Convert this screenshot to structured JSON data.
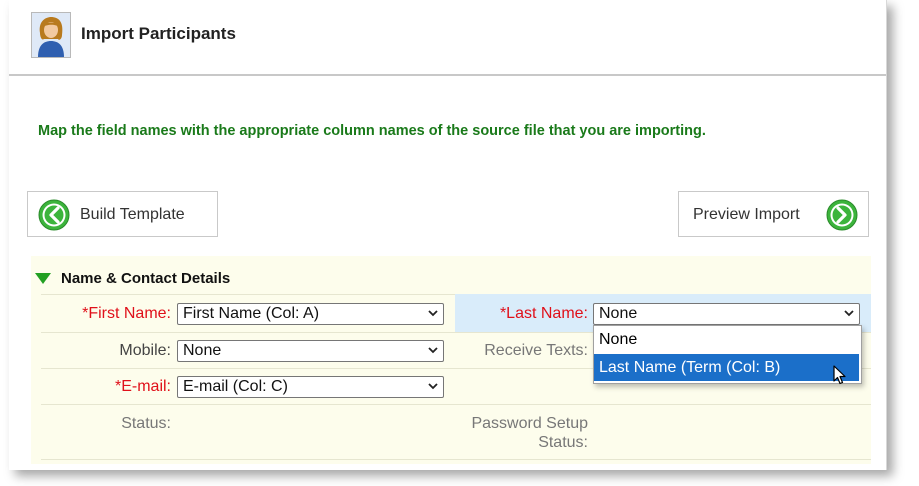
{
  "header": {
    "title": "Import Participants",
    "avatar_icon": "user-avatar-icon"
  },
  "instructions": "Map the field names with the appropriate column names of the source file that you are importing.",
  "buttons": {
    "build_template": {
      "label": "Build Template",
      "icon": "arrow-left-circle-icon"
    },
    "preview_import": {
      "label": "Preview Import",
      "icon": "arrow-right-circle-icon"
    }
  },
  "section": {
    "title": "Name & Contact Details",
    "fields": {
      "first_name": {
        "label": "*First Name:",
        "value": "First Name (Col: A)"
      },
      "last_name": {
        "label": "*Last Name:",
        "value": "None"
      },
      "mobile": {
        "label": "Mobile:",
        "value": "None"
      },
      "receive_texts": {
        "label": "Receive Texts:"
      },
      "email": {
        "label": "*E-mail:",
        "value": "E-mail (Col: C)"
      },
      "status": {
        "label": "Status:"
      },
      "password_setup_status": {
        "label_line1": "Password Setup",
        "label_line2": "Status:"
      }
    }
  },
  "dropdown": {
    "options": [
      "None",
      "Last Name (Term (Col: B)"
    ],
    "highlighted_index": 1
  },
  "colors": {
    "accent_green": "#22a022",
    "instruction_green": "#1a7a1a",
    "required_red": "#e0101a",
    "selection_blue": "#1b6fc9",
    "section_bg": "#fdfdec"
  }
}
